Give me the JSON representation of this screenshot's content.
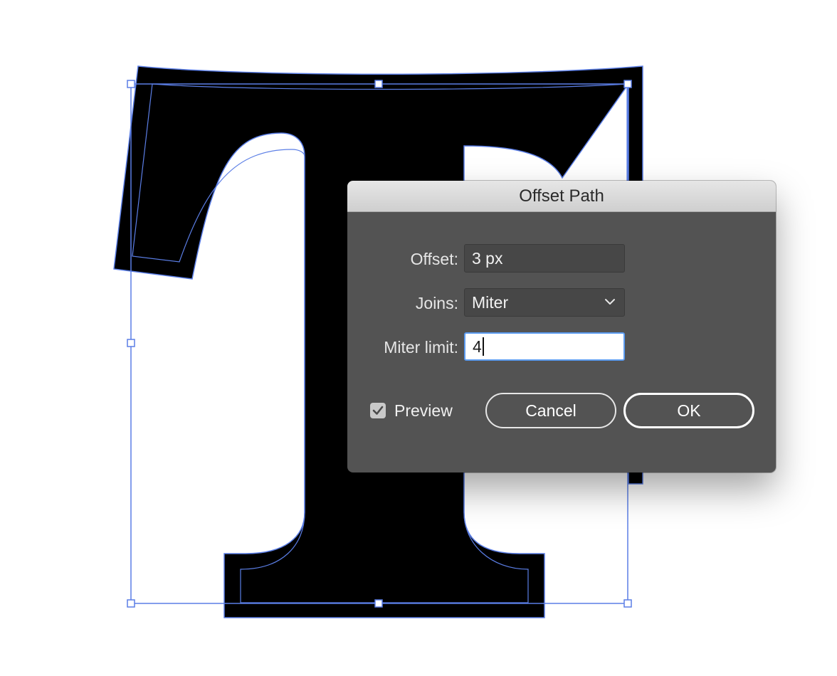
{
  "dialog": {
    "title": "Offset Path",
    "offset": {
      "label": "Offset:",
      "value": "3 px"
    },
    "joins": {
      "label": "Joins:",
      "value": "Miter"
    },
    "miter_limit": {
      "label": "Miter limit:",
      "value": "4"
    },
    "preview": {
      "label": "Preview",
      "checked": true
    },
    "cancel_label": "Cancel",
    "ok_label": "OK"
  },
  "colors": {
    "selection": "#5b7ee6",
    "glyph": "#000000",
    "dialog_bg": "#535353",
    "focus_ring": "#5b9bf0"
  },
  "icons": {
    "dropdown": "chevron-down-icon",
    "checkbox": "checkmark-icon"
  }
}
